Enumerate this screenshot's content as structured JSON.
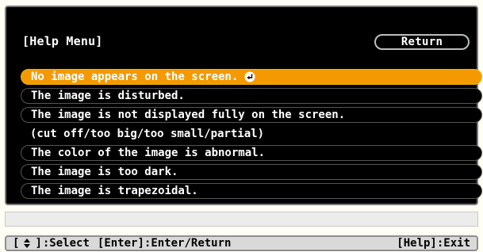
{
  "header": {
    "title": "[Help Menu]",
    "return_label": "Return"
  },
  "menu": {
    "items": [
      "No image appears on the screen.",
      "The image is disturbed.",
      "The image is not displayed fully on the screen.",
      "(cut off/too big/too small/partial)",
      "The color of the image is abnormal.",
      "The image is too dark.",
      "The image is trapezoidal."
    ],
    "selected_index": 0
  },
  "footer": {
    "select_label": ":Select",
    "enter_label": "[Enter]:Enter/Return",
    "help_label": "[Help]:Exit"
  },
  "icons": {
    "enter": "enter-return-icon",
    "updown": "up-down-arrows-icon"
  },
  "colors": {
    "panel_background": "#000000",
    "selected_item": "#f49a00",
    "page_background": "#fffef4",
    "footer_background": "#d9d9d9"
  }
}
